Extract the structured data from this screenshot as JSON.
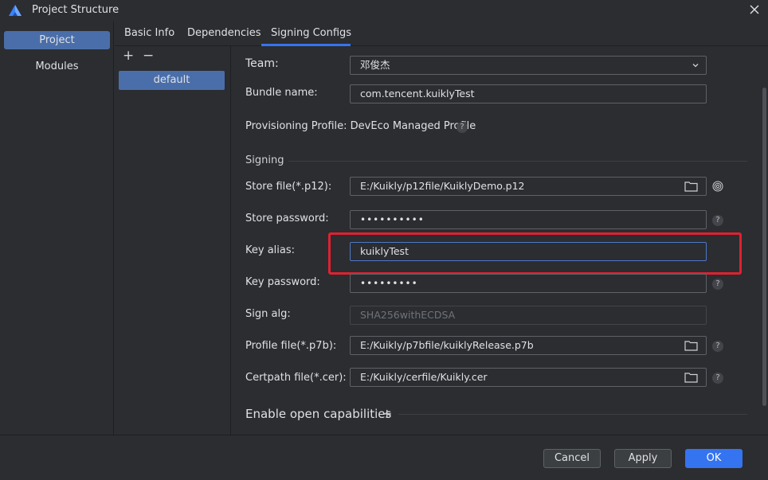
{
  "window": {
    "title": "Project Structure",
    "close_label": "close"
  },
  "nav": {
    "items": [
      {
        "label": "Project",
        "selected": true
      },
      {
        "label": "Modules",
        "selected": false
      }
    ]
  },
  "tabs": [
    {
      "label": "Basic Info"
    },
    {
      "label": "Dependencies"
    },
    {
      "label": "Signing Configs",
      "active": true
    }
  ],
  "config_list": {
    "add_label": "+",
    "remove_label": "−",
    "items": [
      {
        "label": "default",
        "selected": true
      }
    ]
  },
  "form": {
    "team_label": "Team:",
    "team_value": "邓俊杰",
    "bundle_label": "Bundle name:",
    "bundle_value": "com.tencent.kuiklyTest",
    "provisioning_text": "Provisioning Profile: DevEco Managed Profile",
    "signing_section": "Signing",
    "store_file_label": "Store file(*.p12):",
    "store_file_value": "E:/Kuikly/p12file/KuiklyDemo.p12",
    "store_password_label": "Store password:",
    "store_password_value": "••••••••••",
    "key_alias_label": "Key alias:",
    "key_alias_value": "kuiklyTest",
    "key_password_label": "Key password:",
    "key_password_value": "•••••••••",
    "sign_alg_label": "Sign alg:",
    "sign_alg_value": "SHA256withECDSA",
    "profile_file_label": "Profile file(*.p7b):",
    "profile_file_value": "E:/Kuikly/p7bfile/kuiklyRelease.p7b",
    "certpath_label": "Certpath file(*.cer):",
    "certpath_value": "E:/Kuikly/cerfile/Kuikly.cer",
    "open_capabilities_label": "Enable open capabilities",
    "open_capabilities_plus": "+",
    "help": "?"
  },
  "footer": {
    "cancel_label": "Cancel",
    "apply_label": "Apply",
    "ok_label": "OK"
  },
  "colors": {
    "accent": "#3574f0",
    "selection": "#4a6ea9",
    "highlight_box": "#e02130",
    "background": "#2b2d30"
  },
  "icons": {
    "app": "deveco-logo-icon",
    "close": "close-icon",
    "chevron": "chevron-down-icon",
    "folder": "folder-icon",
    "fingerprint": "fingerprint-icon",
    "help": "help-icon"
  }
}
